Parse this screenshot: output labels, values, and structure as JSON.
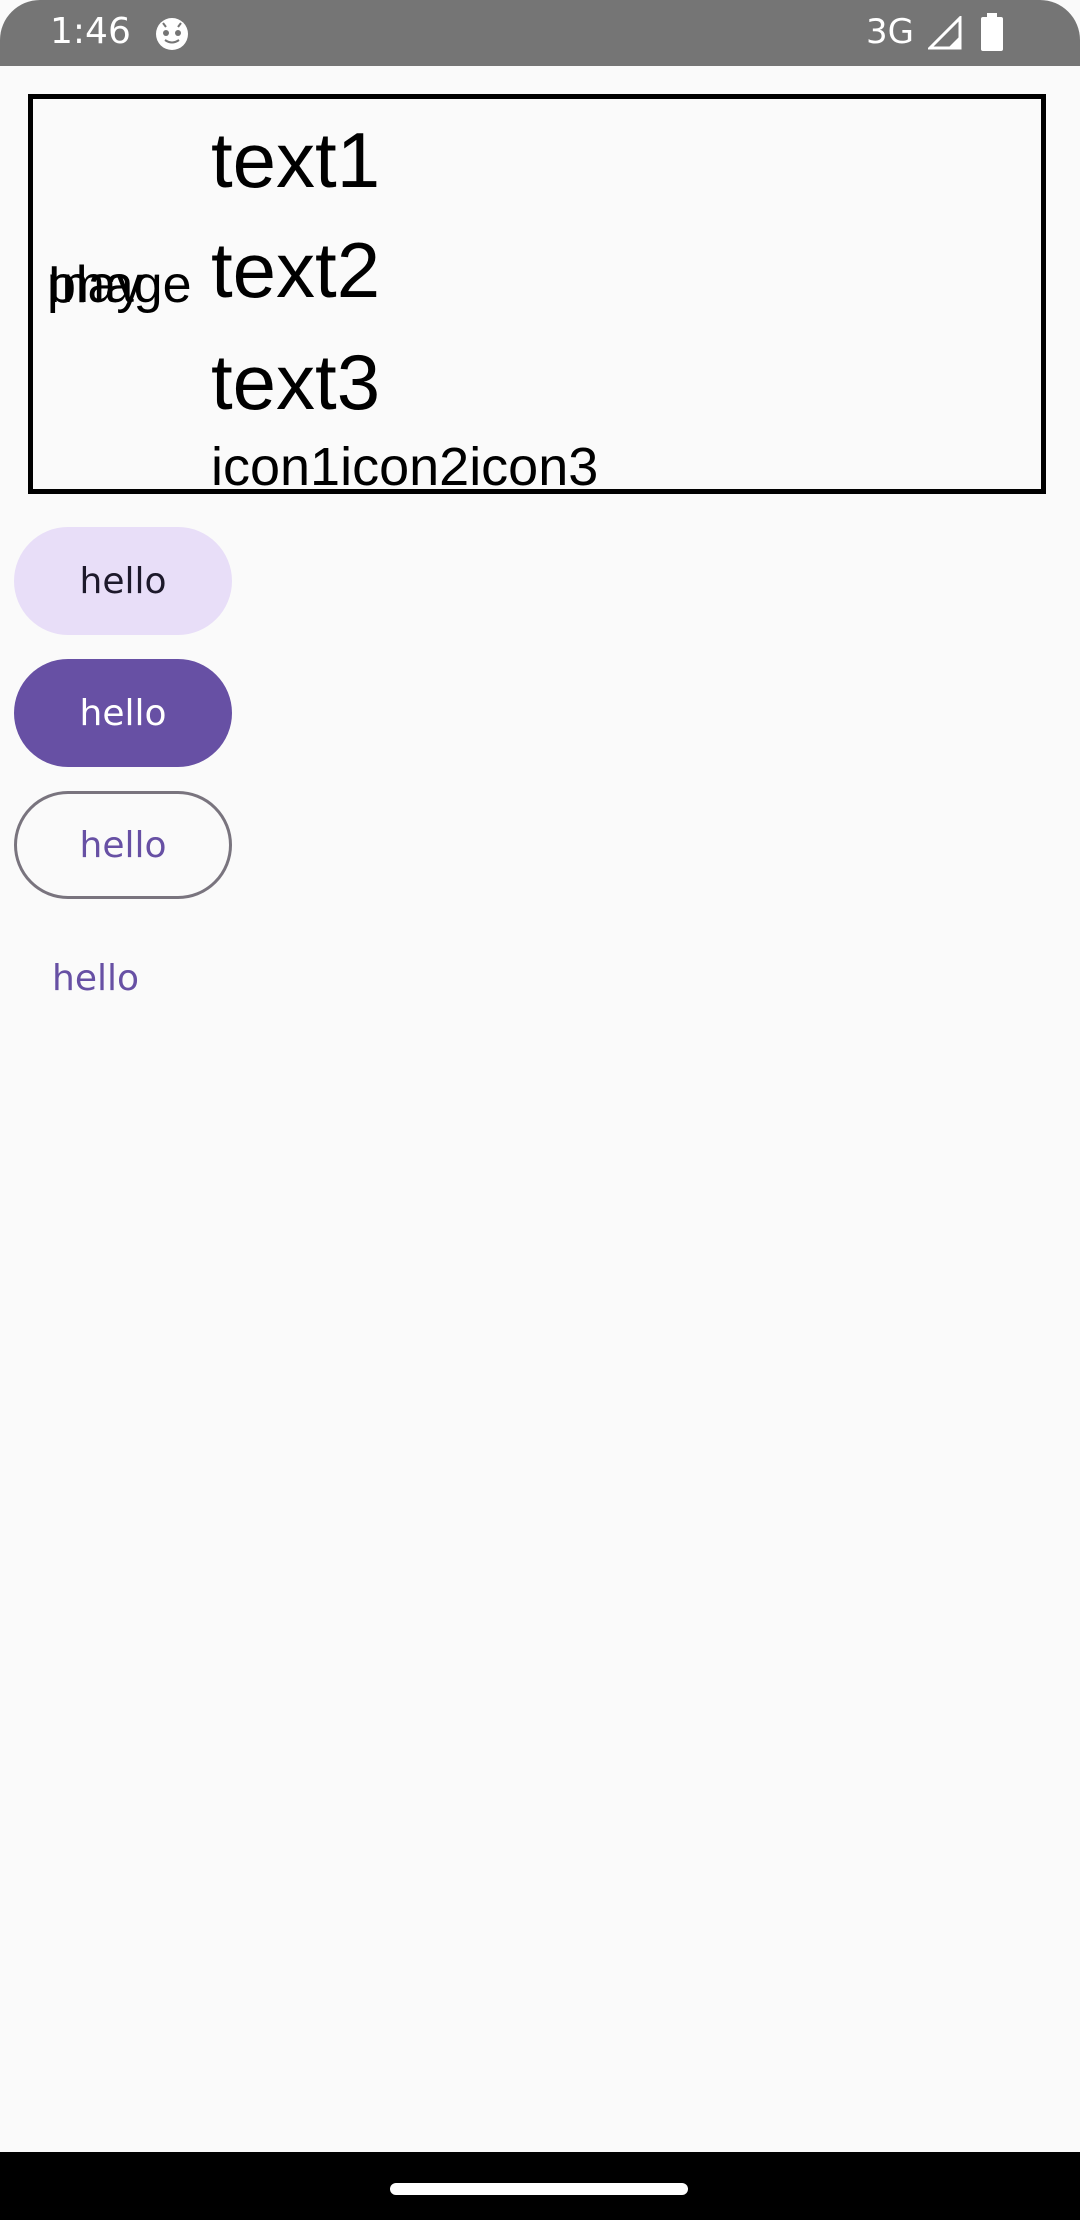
{
  "status_bar": {
    "time": "1:46",
    "network": "3G",
    "app_icon": "android-debug-icon",
    "signal_icon": "signal-icon",
    "battery_icon": "battery-icon"
  },
  "card": {
    "overlap_label_1": "Image",
    "overlap_label_2": "play",
    "texts": [
      "text1",
      "text2",
      "text3"
    ],
    "icons_line": "icon1icon2icon3"
  },
  "buttons": {
    "tonal_label": "hello",
    "filled_label": "hello",
    "outlined_label": "hello",
    "text_label": "hello"
  },
  "colors": {
    "primary": "#6750a4",
    "secondary_container": "#e8def8",
    "outline": "#79747e",
    "status_bar": "#757575",
    "background": "#fafafa"
  }
}
